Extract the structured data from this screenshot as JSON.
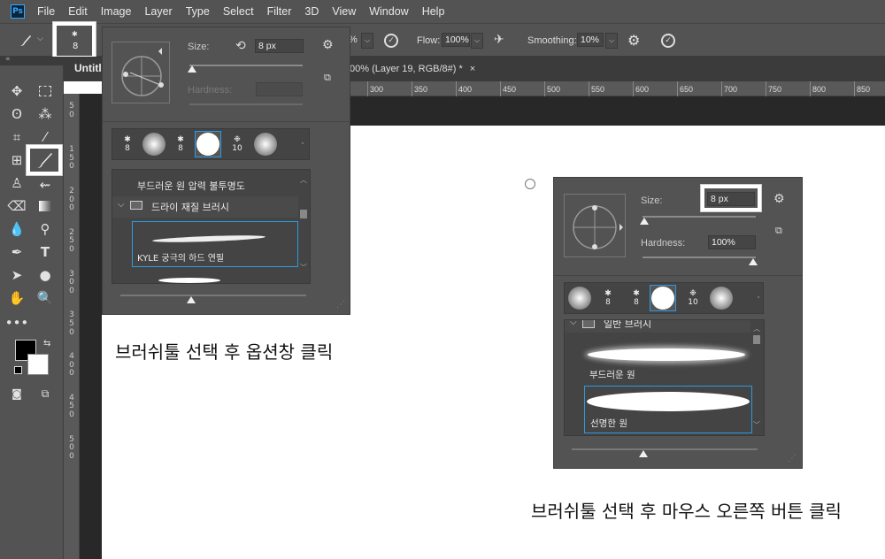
{
  "app": {
    "logo": "Ps"
  },
  "menu": [
    "File",
    "Edit",
    "Image",
    "Layer",
    "Type",
    "Select",
    "Filter",
    "3D",
    "View",
    "Window",
    "Help"
  ],
  "options_bar": {
    "brush_size_preview": "8",
    "opacity_fragment": "%",
    "flow_label": "Flow:",
    "flow_value": "100%",
    "smoothing_label": "Smoothing:",
    "smoothing_value": "10%"
  },
  "tabs": {
    "left_tab": "Untitle",
    "right_tab": "00% (Layer 19, RGB/8#) *",
    "close": "×"
  },
  "ruler": {
    "h_ticks": [
      "300",
      "350",
      "400",
      "450",
      "500",
      "550",
      "600",
      "650",
      "700",
      "750",
      "800",
      "850"
    ],
    "v_ticks": [
      "5",
      "0",
      "1",
      "5",
      "0",
      "2",
      "0",
      "0",
      "2",
      "5",
      "0",
      "3",
      "0",
      "0",
      "3",
      "5",
      "0",
      "4",
      "0",
      "0",
      "4",
      "5",
      "0",
      "5",
      "0",
      "0"
    ]
  },
  "panel_left": {
    "size_label": "Size:",
    "size_value": "8 px",
    "hardness_label": "Hardness:",
    "presets": [
      "8",
      "8",
      "10"
    ],
    "list_items": {
      "item_top": "부드러운 원 압력 불투명도",
      "folder": "드라이 재질 브러시",
      "selected": "KYLE 궁극의 하드 연필"
    },
    "caption": "브러쉬툴 선택 후 옵션창 클릭"
  },
  "panel_right": {
    "size_label": "Size:",
    "size_value": "8 px",
    "hardness_label": "Hardness:",
    "hardness_value": "100%",
    "presets": [
      "8",
      "8",
      "10"
    ],
    "list_items": {
      "folder": "일반 브러시",
      "item_soft": "부드러운 원",
      "item_hard": "선명한 원"
    },
    "caption": "브러쉬툴 선택 후 마우스 오른쪽 버튼 클릭"
  },
  "colors": {
    "ui_gray": "#535353",
    "accent_blue": "#2c9be0",
    "dark": "#282828"
  }
}
